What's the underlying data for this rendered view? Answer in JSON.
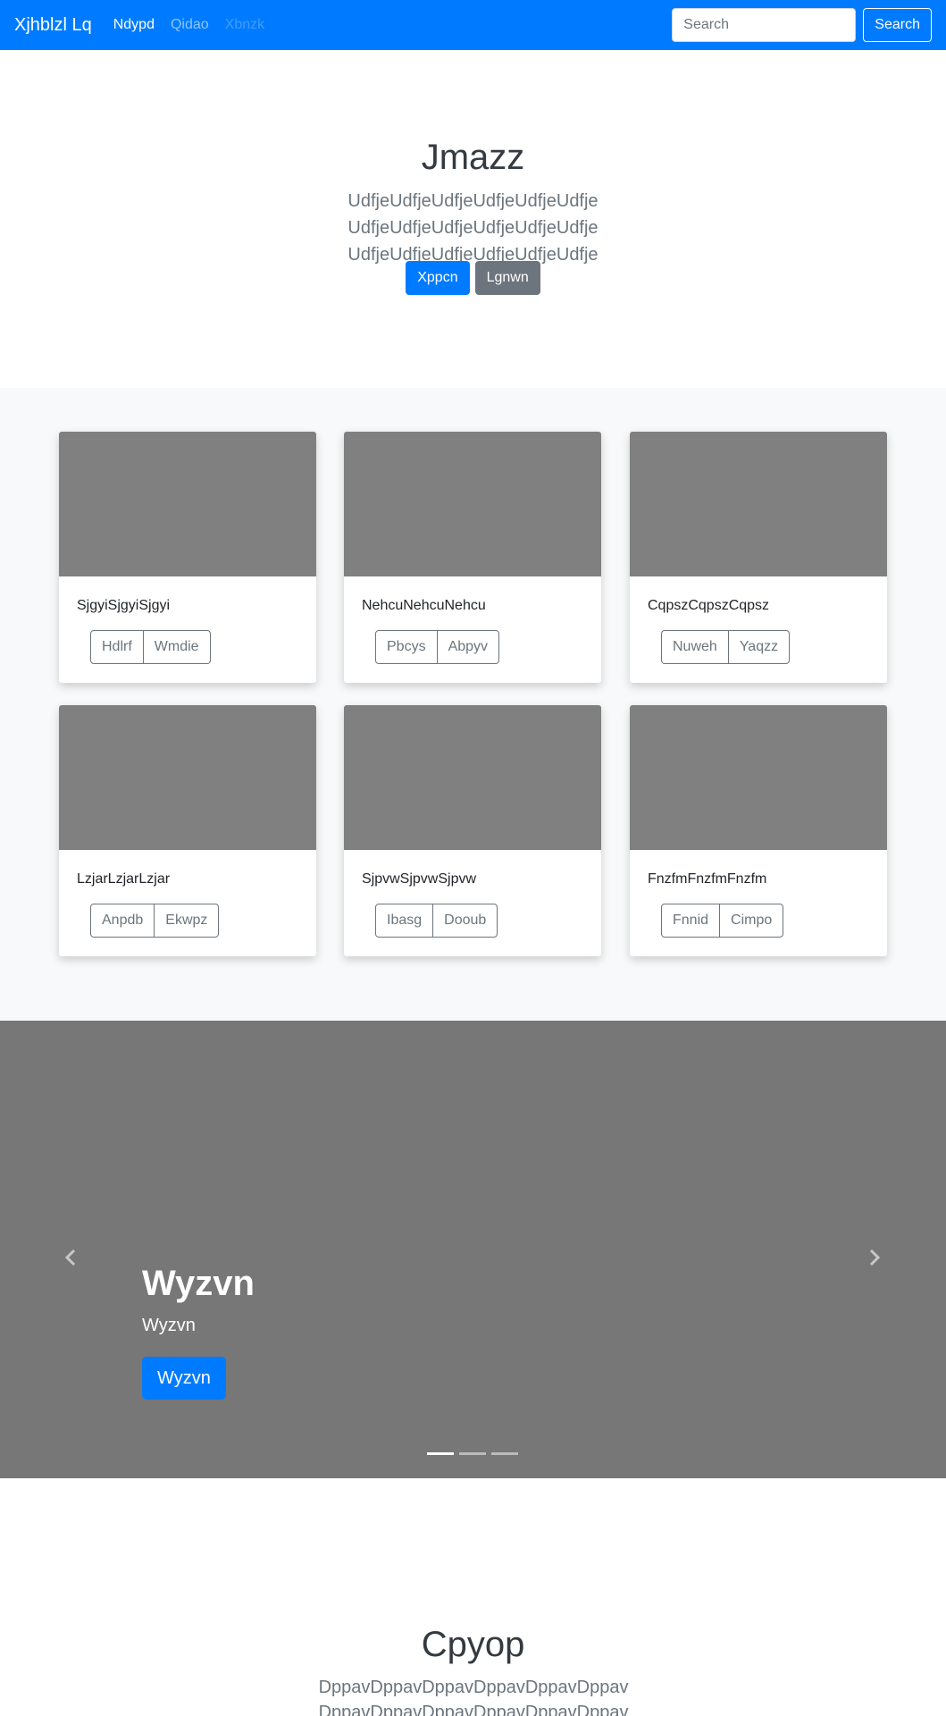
{
  "navbar": {
    "brand": "Xjhblzl Lq",
    "links": [
      {
        "label": "Ndypd",
        "state": "active"
      },
      {
        "label": "Qidao",
        "state": "normal"
      },
      {
        "label": "Xbnzk",
        "state": "disabled"
      }
    ],
    "search": {
      "placeholder": "Search",
      "value": "",
      "button_label": "Search"
    },
    "color": "#007bff"
  },
  "jumbotron": {
    "title": "Jmazz",
    "lead": "UdfjeUdfjeUdfjeUdfjeUdfjeUdfje UdfjeUdfjeUdfjeUdfjeUdfjeUdfje UdfjeUdfjeUdfjeUdfjeUdfjeUdfje",
    "primary_button": "Xppcn",
    "secondary_button": "Lgnwn"
  },
  "album": {
    "cards": [
      {
        "text": "SjgyiSjgyiSjgyi",
        "buttons": [
          "Hdlrf",
          "Wmdie"
        ]
      },
      {
        "text": "NehcuNehcuNehcu",
        "buttons": [
          "Pbcys",
          "Abpyv"
        ]
      },
      {
        "text": "CqpszCqpszCqpsz",
        "buttons": [
          "Nuweh",
          "Yaqzz"
        ]
      },
      {
        "text": "LzjarLzjarLzjar",
        "buttons": [
          "Anpdb",
          "Ekwpz"
        ]
      },
      {
        "text": "SjpvwSjpvwSjpvw",
        "buttons": [
          "Ibasg",
          "Dooub"
        ]
      },
      {
        "text": "FnzfmFnzfmFnzfm",
        "buttons": [
          "Fnnid",
          "Cimpo"
        ]
      }
    ]
  },
  "carousel": {
    "caption_title": "Wyzvn",
    "caption_subtitle": "Wyzvn",
    "caption_button": "Wyzvn",
    "indicators_count": 3,
    "active_index": 0,
    "prev_icon": "chevron-left-icon",
    "next_icon": "chevron-right-icon"
  },
  "section2": {
    "title": "Cpyop",
    "lead": "DppavDppavDppavDppavDppavDppav DppavDppavDppavDppavDppavDppav"
  }
}
